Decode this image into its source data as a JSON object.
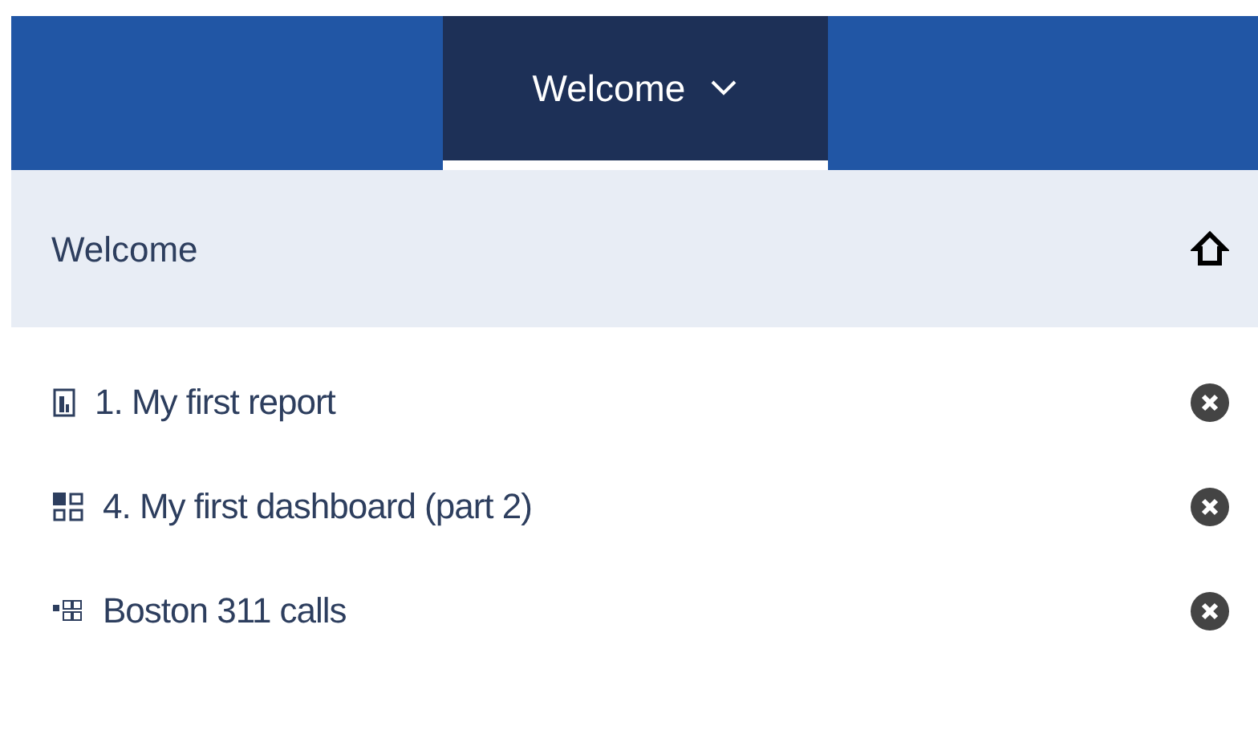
{
  "header": {
    "menu_label": "Welcome"
  },
  "home_row": {
    "label": "Welcome"
  },
  "items": [
    {
      "kind": "report",
      "label": "1. My first report"
    },
    {
      "kind": "dashboard",
      "label": "4. My first dashboard (part 2)"
    },
    {
      "kind": "exploration",
      "label": "Boston 311 calls"
    }
  ]
}
